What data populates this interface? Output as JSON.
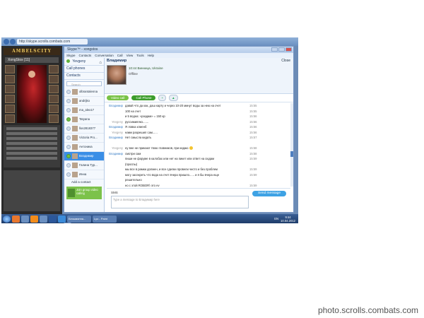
{
  "browser": {
    "address": "http://skype.scrolls.combats.com"
  },
  "game": {
    "logo": "AMBELSCITY",
    "nick": "XongStos [11]"
  },
  "skype": {
    "title": "Skype™ - xongstos",
    "menu": [
      "Skype",
      "Contacts",
      "Conversation",
      "Call",
      "View",
      "Tools",
      "Help"
    ],
    "status_user": "Yevgeny",
    "call_phones": "Call phones",
    "contacts_label": "Contacts",
    "search_placeholder": "Search",
    "contacts": [
      {
        "name": "olbrantalenna",
        "online": false
      },
      {
        "name": "andrijko",
        "online": false
      },
      {
        "name": "ma_alex17",
        "online": false
      },
      {
        "name": "Tatyana",
        "online": true
      },
      {
        "name": "llos2818377",
        "online": false
      },
      {
        "name": "Victoria Pro...",
        "online": false
      },
      {
        "name": "Антоника",
        "online": false
      },
      {
        "name": "Владимир",
        "online": true,
        "active": true
      },
      {
        "name": "Галина Тур...",
        "online": false
      },
      {
        "name": "Инна",
        "online": false
      }
    ],
    "add_contact": "Add a contact",
    "promo": "Join group video calling",
    "conversation": {
      "name": "Владимир",
      "close": "Close",
      "location": "10:44 Винница, Ukraine",
      "status": "Offline",
      "video_call": "Video call",
      "call_phone": "Call Phone",
      "messages": [
        {
          "who": "Владимир",
          "me": false,
          "text": "давай что да как, даш карту и через 10-20 минут воды за нею на счет",
          "time": "15:55"
        },
        {
          "who": "",
          "me": false,
          "text": "100 на счет",
          "time": "15:55"
        },
        {
          "who": "",
          "me": false,
          "text": "и 5 водна: «раздам» = 150 кр",
          "time": "15:56"
        },
        {
          "who": "Yevgeny",
          "me": true,
          "text": "руссимиялко.......",
          "time": "15:56"
        },
        {
          "who": "Владимир",
          "me": false,
          "text": "Я ловка клиенб",
          "time": "15:56"
        },
        {
          "who": "Yevgeny",
          "me": true,
          "text": "нами разрешил сам......",
          "time": "15:56"
        },
        {
          "who": "Владимир",
          "me": false,
          "text": "Нет смысла кидать",
          "time": "15:57"
        },
        {
          "who": "",
          "me": false,
          "text": "",
          "time": ""
        },
        {
          "who": "Yevgeny",
          "me": true,
          "text": "ну вне не прикают твою главников, при кидаю",
          "time": "15:58",
          "smile": true
        },
        {
          "who": "Владимир",
          "me": false,
          "text": "смотри сам",
          "time": "15:58"
        },
        {
          "who": "",
          "me": false,
          "text": "пиши не форуме в калобах или нет на пикет или ответ на сюдам",
          "time": "15:59"
        },
        {
          "who": "",
          "me": false,
          "text": "(проспы)",
          "time": ""
        },
        {
          "who": "",
          "me": false,
          "text": "мы все в рамки должен, и все сделки провели чисто и без проблем",
          "time": "15:59"
        },
        {
          "who": "",
          "me": false,
          "text": "могу засекреть что вода на счет вчера пришло...... и я бы вчера еще",
          "time": "15:59"
        },
        {
          "who": "",
          "me": false,
          "text": "решительно",
          "time": ""
        },
        {
          "who": "",
          "me": false,
          "text": "но с этой ROBOR) это ну",
          "time": "15:59"
        },
        {
          "who": "Владимир",
          "me": false,
          "text": "а все понимаю, но это не говорят в твоих пользу......твои друзья, дружите в",
          "time": "16:00"
        },
        {
          "who": "",
          "me": false,
          "text": "раших, естественно они скажут, ДАААА ОН ВЕСТРОБЛЕМ",
          "time": ""
        },
        {
          "who": "Yevgeny",
          "me": true,
          "text": "то ит понятно, я меня вещну, это 100 вода и на не до денег все на которых",
          "time": "16:13"
        },
        {
          "who": "",
          "me": false,
          "text": "ответ поджарилось и начит чтоб она",
          "time": ""
        }
      ],
      "sms_label": "SMS",
      "input_placeholder": "Type a message to Владимир here",
      "send": "Send message"
    }
  },
  "taskbar": {
    "tasks": [
      "Безымянна...",
      "Lyo - Paint"
    ],
    "lang": "EN",
    "time": "9:44",
    "date": "10.04.2012"
  },
  "watermark": "photo.scrolls.combats.com"
}
